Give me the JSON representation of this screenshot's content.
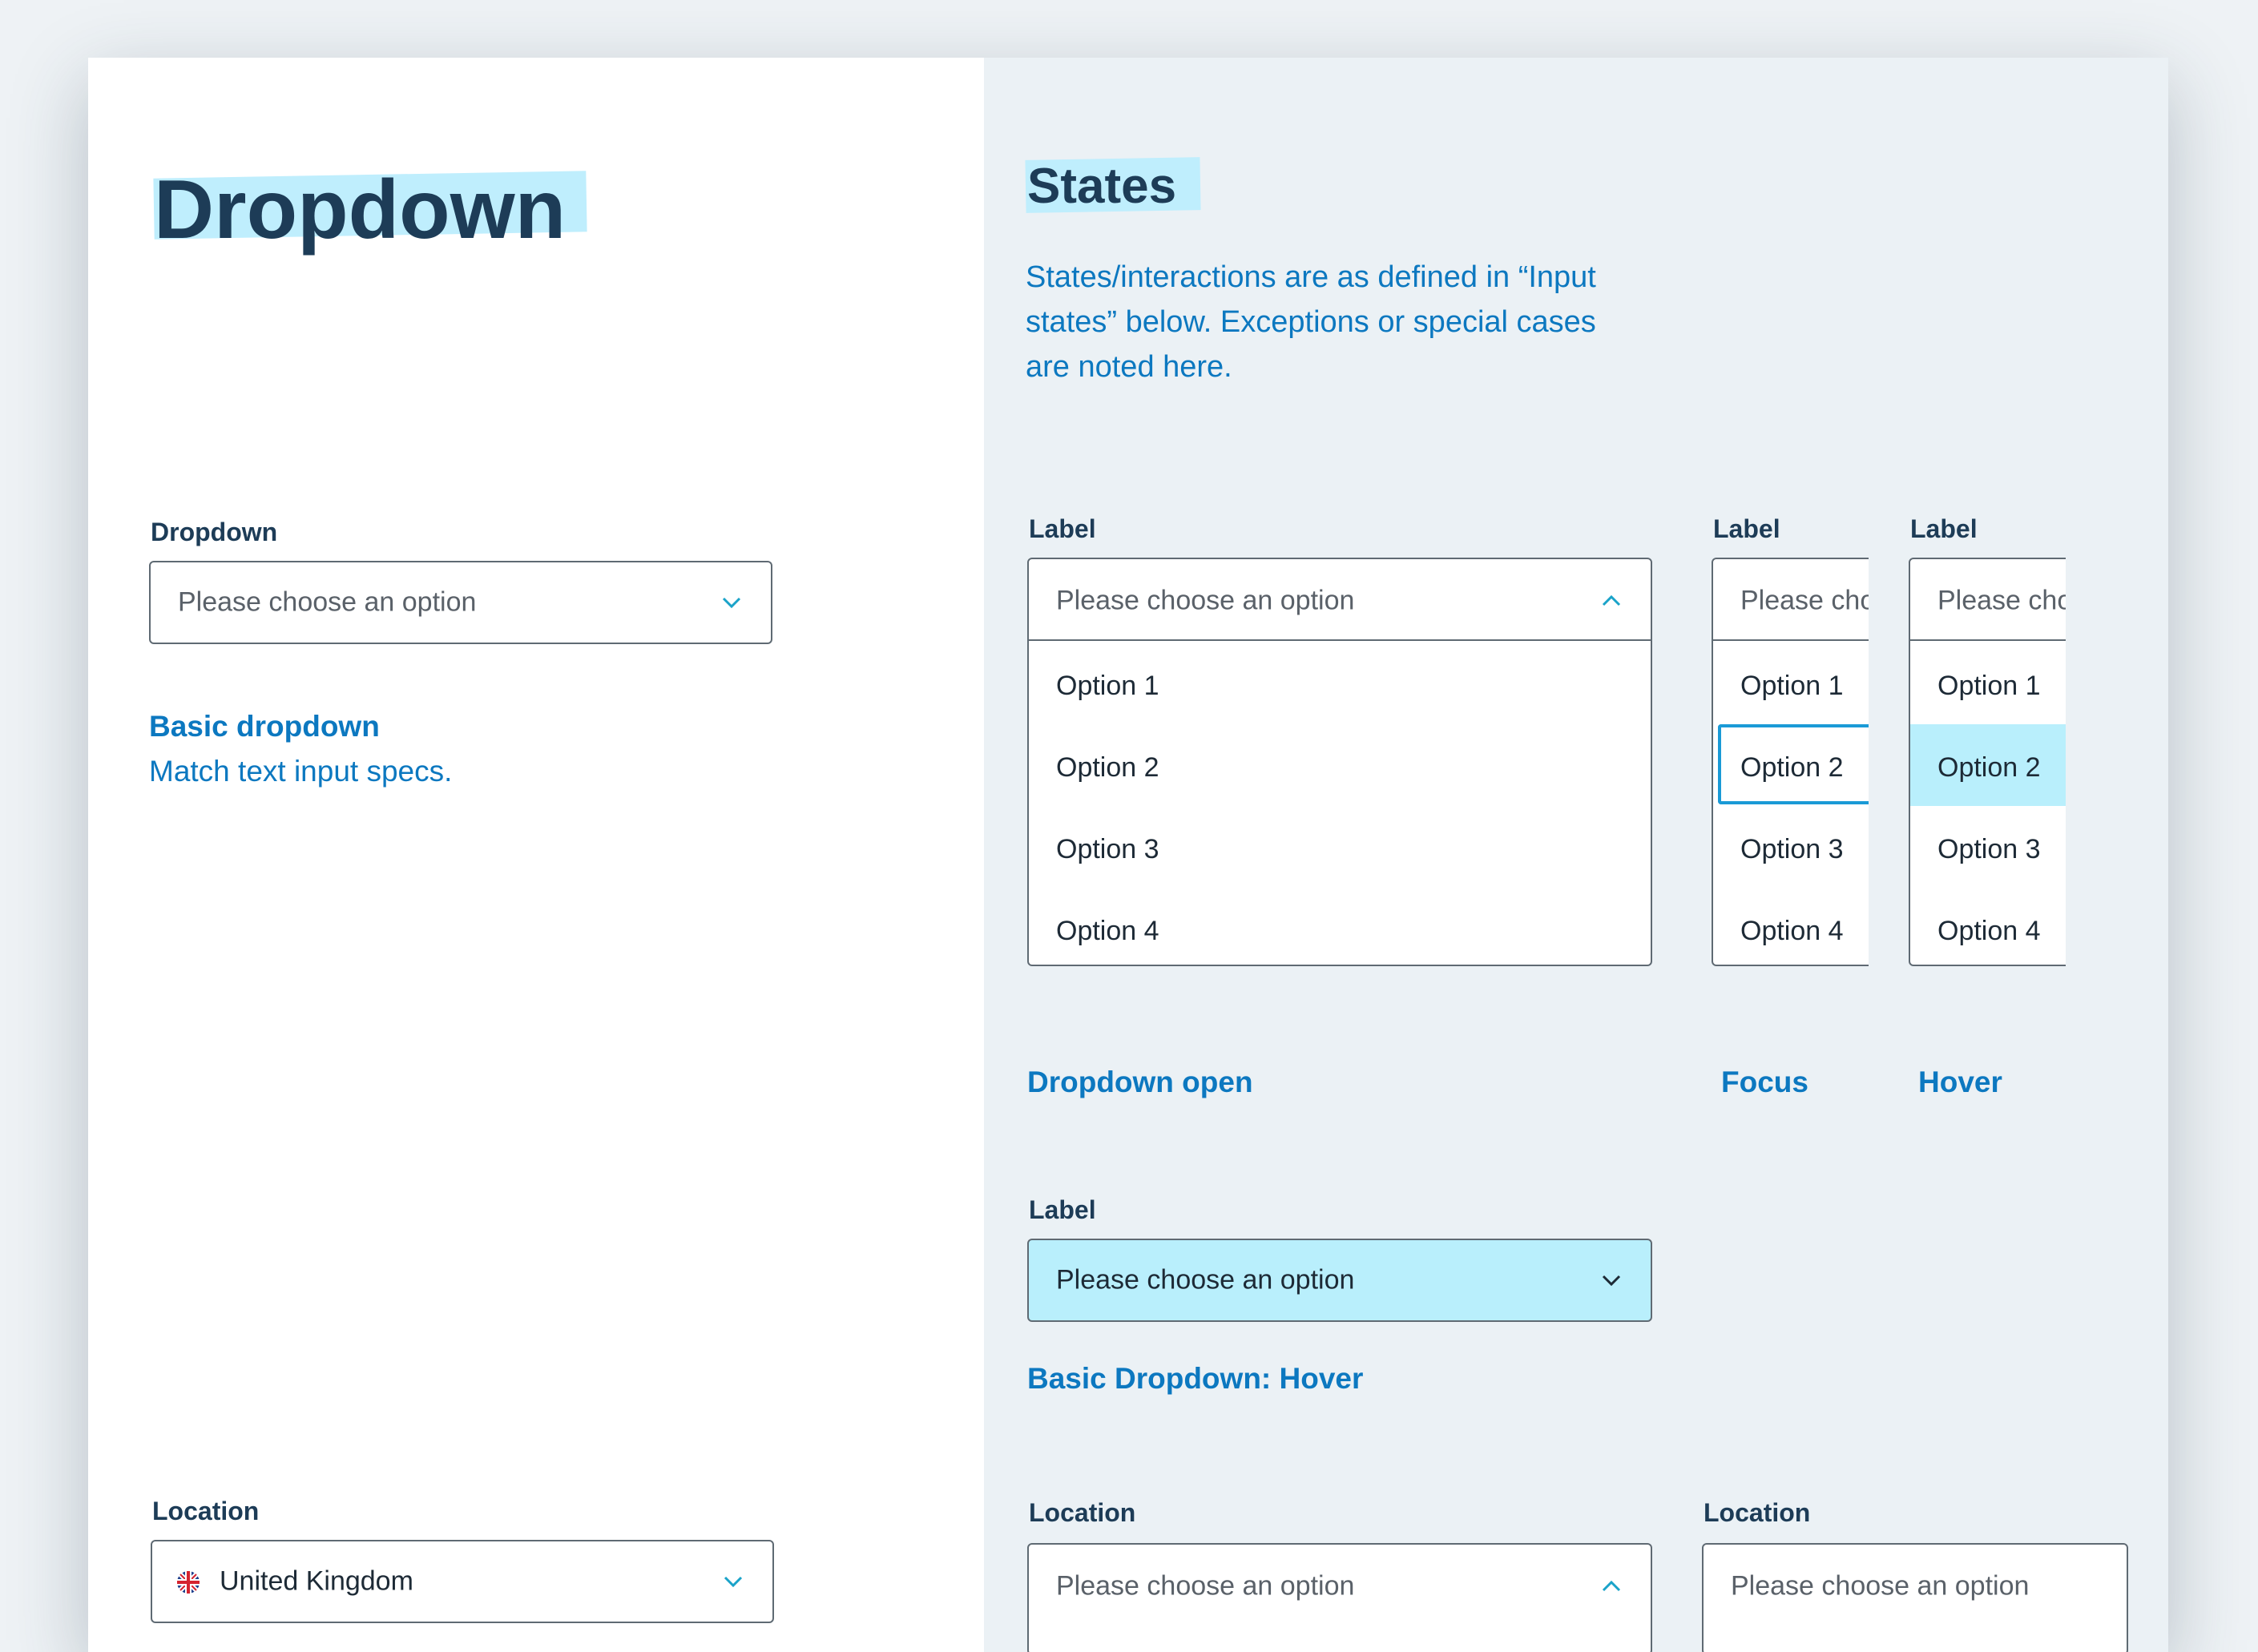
{
  "page": {
    "title": "Dropdown"
  },
  "basic": {
    "label": "Dropdown",
    "placeholder": "Please choose an option",
    "caption_title": "Basic dropdown",
    "caption_text": "Match text input specs."
  },
  "location_left": {
    "label": "Location",
    "value": "United Kingdom",
    "flag_icon": "uk-flag-icon"
  },
  "states": {
    "title": "States",
    "description_line1": "States/interactions are as defined in “Input",
    "description_line2": "states” below. Exceptions or special cases",
    "description_line3": "are noted here."
  },
  "open_dropdown": {
    "label": "Label",
    "placeholder": "Please choose an option",
    "options": [
      "Option 1",
      "Option 2",
      "Option 3",
      "Option 4"
    ],
    "caption": "Dropdown open"
  },
  "focus_dropdown": {
    "label": "Label",
    "placeholder": "Please cho",
    "options": [
      "Option 1",
      "Option 2",
      "Option 3",
      "Option 4"
    ],
    "caption": "Focus"
  },
  "hover_dropdown": {
    "label": "Label",
    "placeholder": "Please cho",
    "options": [
      "Option 1",
      "Option 2",
      "Option 3",
      "Option 4"
    ],
    "caption": "Hover"
  },
  "hover_basic": {
    "label": "Label",
    "placeholder": "Please choose an option",
    "caption": "Basic Dropdown: Hover"
  },
  "location_mid": {
    "label": "Location",
    "placeholder": "Please choose an option"
  },
  "location_right": {
    "label": "Location",
    "placeholder": "Please choose an option"
  },
  "colors": {
    "accent_blue": "#0c78c0",
    "highlight_cyan": "#bfeefd",
    "hover_fill": "#b9effc",
    "heading_navy": "#1d3c57",
    "focus_border": "#1a9ad6",
    "chevron_teal": "#1aa3c9"
  }
}
